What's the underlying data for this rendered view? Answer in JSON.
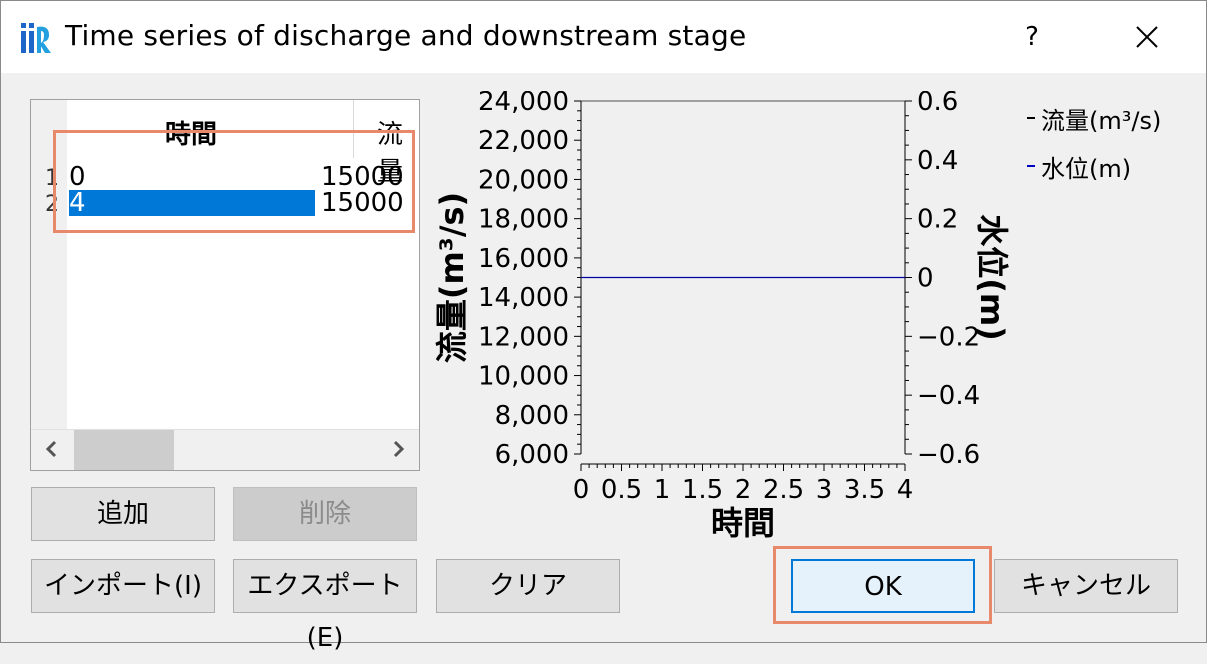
{
  "window": {
    "title": "Time series of discharge and downstream stage",
    "help_label": "?",
    "icon": "iric-logo-icon"
  },
  "table": {
    "columns": [
      "時間",
      "流量"
    ],
    "rows": [
      {
        "num": "1",
        "time": "0",
        "flow": "15000",
        "selected": false
      },
      {
        "num": "2",
        "time": "4",
        "flow": "15000",
        "selected": true
      }
    ]
  },
  "buttons": {
    "add": "追加",
    "delete": "削除",
    "import": "インポート(I)",
    "export": "エクスポート(E)",
    "clear": "クリア",
    "ok": "OK",
    "cancel": "キャンセル"
  },
  "chart_data": {
    "type": "line",
    "xlabel": "時間",
    "ylabel_left": "流量(m³/s)",
    "ylabel_right": "水位(m)",
    "x_ticks": [
      "0",
      "0.5",
      "1",
      "1.5",
      "2",
      "2.5",
      "3",
      "3.5",
      "4"
    ],
    "y_left_ticks": [
      "24,000",
      "22,000",
      "20,000",
      "18,000",
      "16,000",
      "14,000",
      "12,000",
      "10,000",
      "8,000",
      "6,000"
    ],
    "y_right_ticks": [
      "0.6",
      "0.4",
      "0.2",
      "0",
      "−0.2",
      "−0.4",
      "−0.6"
    ],
    "xlim": [
      0,
      4
    ],
    "ylim_left": [
      6000,
      24000
    ],
    "ylim_right": [
      -0.6,
      0.6
    ],
    "series": [
      {
        "name": "流量(m³/s)",
        "axis": "left",
        "color": "#000000",
        "x": [
          0,
          4
        ],
        "y": [
          15000,
          15000
        ]
      },
      {
        "name": "水位(m)",
        "axis": "right",
        "color": "#0000c0",
        "x": [],
        "y": []
      }
    ],
    "legend_position": "right",
    "grid": false
  }
}
